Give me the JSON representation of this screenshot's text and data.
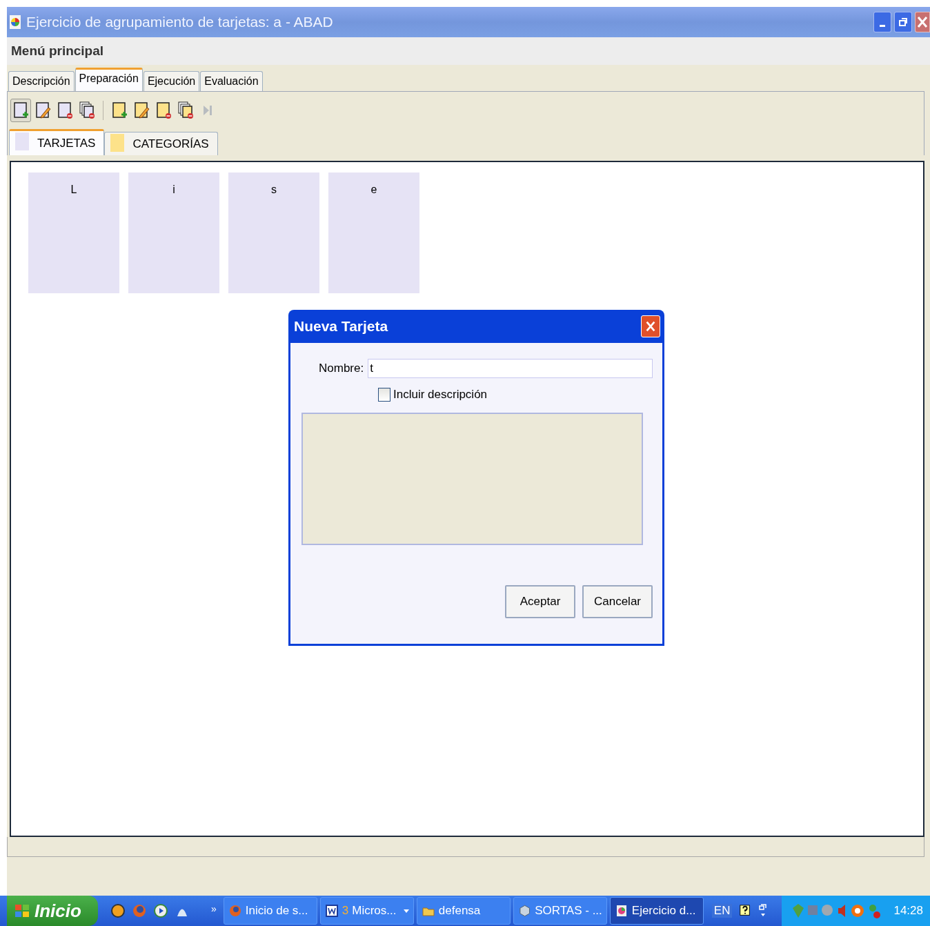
{
  "window": {
    "title": "Ejercicio de agrupamiento de tarjetas: a - ABAD"
  },
  "menu_bar": {
    "label": "Menú principal"
  },
  "tabs": [
    {
      "label": "Descripción",
      "selected": false
    },
    {
      "label": "Preparación",
      "selected": true
    },
    {
      "label": "Ejecución",
      "selected": false
    },
    {
      "label": "Evaluación",
      "selected": false
    }
  ],
  "toolbar": [
    {
      "kind": "card-add",
      "pressed": true
    },
    {
      "kind": "card-edit",
      "pressed": false
    },
    {
      "kind": "card-remove",
      "pressed": false
    },
    {
      "kind": "cards-remove",
      "pressed": false
    },
    {
      "kind": "category-add",
      "pressed": false
    },
    {
      "kind": "category-edit",
      "pressed": false
    },
    {
      "kind": "category-remove",
      "pressed": false
    },
    {
      "kind": "categories-remove",
      "pressed": false
    },
    {
      "kind": "skip",
      "pressed": false
    }
  ],
  "subtabs": [
    {
      "label": "TARJETAS",
      "selected": true,
      "color": "#e6e3f5"
    },
    {
      "label": "CATEGORÍAS",
      "selected": false,
      "color": "#fde28a"
    }
  ],
  "cards": [
    {
      "label": "L"
    },
    {
      "label": "i"
    },
    {
      "label": "s"
    },
    {
      "label": "e"
    }
  ],
  "dialog": {
    "title": "Nueva Tarjeta",
    "name_label": "Nombre:",
    "name_value": "t",
    "checkbox": {
      "label": "Incluir descripción",
      "checked": false
    },
    "buttons": [
      "Aceptar",
      "Cancelar"
    ]
  },
  "taskbar": {
    "start": "Inicio",
    "more": "»",
    "tasks": [
      {
        "kind": "firefox",
        "label": "Inicio de s...",
        "selected": false
      },
      {
        "kind": "word",
        "count": "3",
        "label": "Micros...",
        "selected": false
      },
      {
        "kind": "folder",
        "label": "defensa",
        "selected": false
      },
      {
        "kind": "cube",
        "label": "SORTAS - ...",
        "selected": false
      },
      {
        "kind": "app",
        "label": "Ejercicio d...",
        "selected": true
      }
    ],
    "language": "EN",
    "clock": "14:28"
  }
}
